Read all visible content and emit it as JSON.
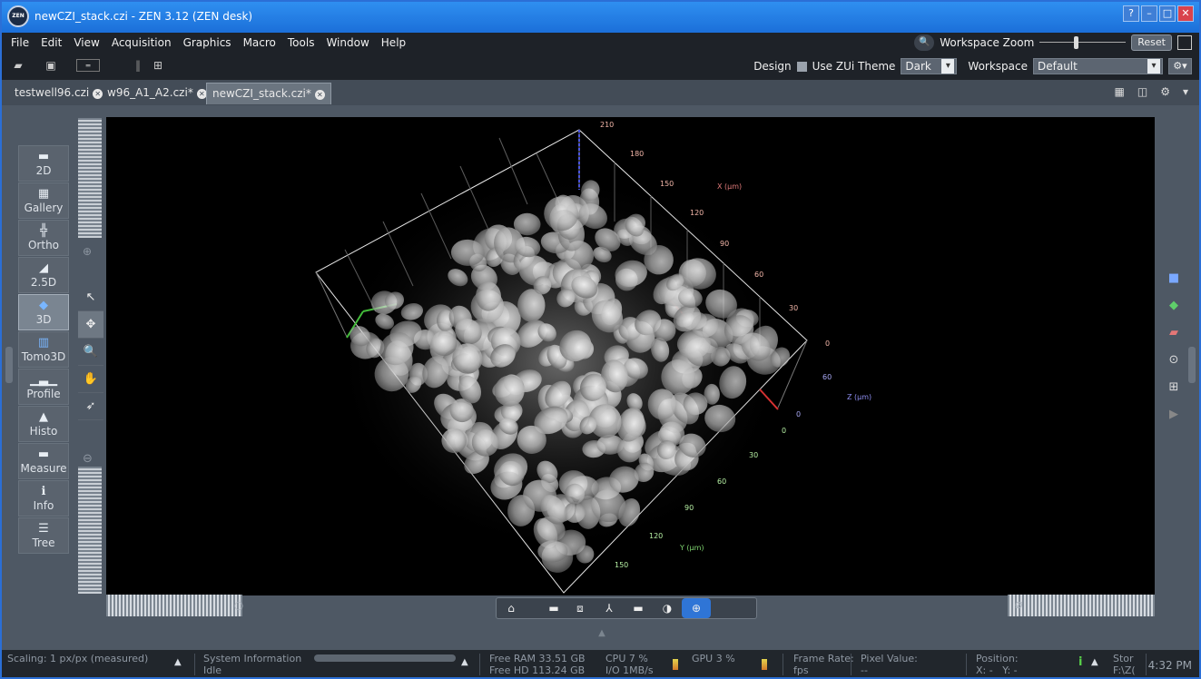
{
  "window": {
    "title": "newCZI_stack.czi - ZEN 3.12 (ZEN desk)",
    "logo_text": "ZEN",
    "controls": [
      "?",
      "–",
      "□",
      "✕"
    ]
  },
  "menu": {
    "items": [
      "File",
      "Edit",
      "View",
      "Acquisition",
      "Graphics",
      "Macro",
      "Tools",
      "Window",
      "Help"
    ],
    "workspace_zoom_label": "Workspace Zoom",
    "reset_label": "Reset"
  },
  "toolbar": {
    "design_label": "Design",
    "use_zui_label": "Use ZUi Theme",
    "theme_value": "Dark",
    "workspace_label": "Workspace",
    "workspace_value": "Default"
  },
  "tabs": [
    {
      "label": "testwell96.czi"
    },
    {
      "label": "w96_A1_A2.czi*"
    },
    {
      "label": "newCZI_stack.czi*"
    }
  ],
  "views": [
    {
      "label": "2D",
      "icon": "2d-view-icon"
    },
    {
      "label": "Gallery",
      "icon": "gallery-icon"
    },
    {
      "label": "Ortho",
      "icon": "ortho-icon"
    },
    {
      "label": "2.5D",
      "icon": "2-5d-icon"
    },
    {
      "label": "3D",
      "icon": "3d-cube-icon"
    },
    {
      "label": "Tomo3D",
      "icon": "tomo3d-icon"
    },
    {
      "label": "Profile",
      "icon": "profile-icon"
    },
    {
      "label": "Histo",
      "icon": "histogram-icon"
    },
    {
      "label": "Measure",
      "icon": "measure-icon"
    },
    {
      "label": "Info",
      "icon": "info-icon"
    },
    {
      "label": "Tree",
      "icon": "tree-icon"
    }
  ],
  "axes": {
    "x_label": "X (µm)",
    "x_ticks": [
      "210",
      "180",
      "150",
      "120",
      "90",
      "60",
      "30",
      "0"
    ],
    "z_label": "Z (µm)",
    "z_ticks": [
      "60",
      "0"
    ],
    "y_label": "Y (µm)",
    "y_ticks": [
      "0",
      "30",
      "60",
      "90",
      "120",
      "150"
    ],
    "colors": {
      "x": "#e07a7a",
      "y": "#7ed36f",
      "z": "#8f8ff2",
      "tick_x": "#f2b5a8",
      "tick_y": "#b6f0a4"
    }
  },
  "status": {
    "scaling": "Scaling:  1 px/px (measured)",
    "system_info": "System Information",
    "system_state": "Idle",
    "free_ram": "Free RAM 33.51 GB",
    "free_hd": "Free HD  113.24 GB",
    "cpu": "CPU 7 %",
    "io": "I/O  1MB/s",
    "gpu": "GPU 3 %",
    "frame_rate_label": "Frame Rate:",
    "frame_rate_unit": "fps",
    "pixel_value_label": "Pixel Value:",
    "pixel_value": "--",
    "position_label": "Position:",
    "position_x": "X: -",
    "position_y": "Y: -",
    "storage": "Stor",
    "storage_path": "F:\\Z(",
    "time": "4:32 PM"
  }
}
